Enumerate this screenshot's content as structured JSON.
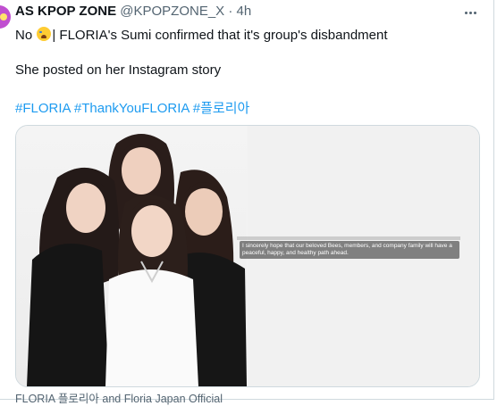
{
  "tweet": {
    "name": "AS KPOP ZONE",
    "handle": "@KPOPZONE_X",
    "separator": "·",
    "time": "4h",
    "line1_before": "No",
    "line1_after": "| FLORIA's Sumi confirmed that it's group's disbandment",
    "line2": "She posted on her Instagram story",
    "hashtags": [
      "#FLORIA",
      "#ThankYouFLORIA",
      "#플로리아"
    ]
  },
  "media": {
    "story_text": "I sincerely hope that our beloved Bees, members, and company family will have a peaceful, happy, and healthy path ahead.",
    "caption": "FLORIA 플로리아 and Floria Japan Official"
  },
  "colors": {
    "accent": "#1d9bf0",
    "secondary_text": "#536471"
  },
  "icons": {
    "more": "more-horizontal-icon",
    "emoji": "crying-face-emoji"
  }
}
